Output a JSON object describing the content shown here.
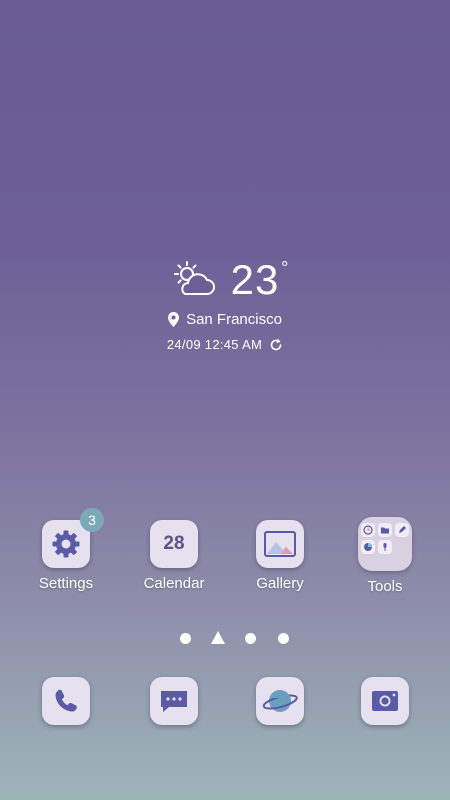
{
  "weather": {
    "temperature": "23",
    "unit": "°",
    "location": "San Francisco",
    "updated": "24/09 12:45 AM",
    "icon": "partly-cloudy-icon"
  },
  "apps": [
    {
      "label": "Settings",
      "icon": "settings-gear-icon",
      "badge": "3"
    },
    {
      "label": "Calendar",
      "icon": "calendar-icon",
      "date": "28"
    },
    {
      "label": "Gallery",
      "icon": "gallery-icon"
    },
    {
      "label": "Tools",
      "icon": "tools-folder-icon"
    }
  ],
  "pager": {
    "pages": 4,
    "current_indicator": "home-indicator-icon"
  },
  "dock": [
    {
      "icon": "phone-icon"
    },
    {
      "icon": "messages-icon"
    },
    {
      "icon": "internet-icon"
    },
    {
      "icon": "camera-icon"
    }
  ],
  "colors": {
    "icon_bg": "#e6e1ee",
    "icon_accent": "#5a5aa6",
    "badge": "#7ba9b8",
    "wallpaper_top": "#6a5b93",
    "wallpaper_bottom": "#9db5b9"
  }
}
